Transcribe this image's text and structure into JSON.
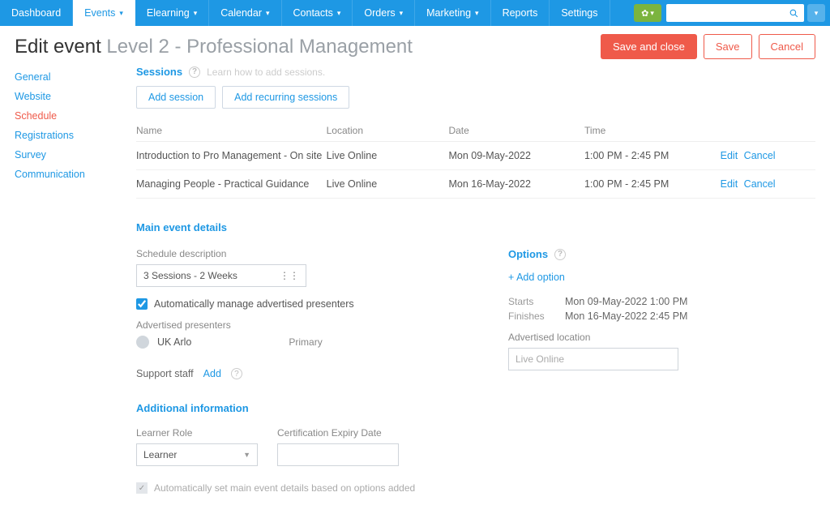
{
  "nav": {
    "items": [
      {
        "label": "Dashboard",
        "active": false,
        "caret": false
      },
      {
        "label": "Events",
        "active": true,
        "caret": true
      },
      {
        "label": "Elearning",
        "active": false,
        "caret": true
      },
      {
        "label": "Calendar",
        "active": false,
        "caret": true
      },
      {
        "label": "Contacts",
        "active": false,
        "caret": true
      },
      {
        "label": "Orders",
        "active": false,
        "caret": true
      },
      {
        "label": "Marketing",
        "active": false,
        "caret": true
      },
      {
        "label": "Reports",
        "active": false,
        "caret": false
      },
      {
        "label": "Settings",
        "active": false,
        "caret": false
      }
    ]
  },
  "header": {
    "edit_label": "Edit event",
    "event_name": "Level 2 - Professional Management"
  },
  "actions": {
    "save_close": "Save and close",
    "save": "Save",
    "cancel": "Cancel"
  },
  "sidebar": {
    "items": [
      {
        "label": "General",
        "active": false
      },
      {
        "label": "Website",
        "active": false
      },
      {
        "label": "Schedule",
        "active": true
      },
      {
        "label": "Registrations",
        "active": false
      },
      {
        "label": "Survey",
        "active": false
      },
      {
        "label": "Communication",
        "active": false
      }
    ]
  },
  "sessions": {
    "title": "Sessions",
    "learn": "Learn how to add sessions.",
    "add_session": "Add session",
    "add_recurring": "Add recurring sessions",
    "columns": {
      "name": "Name",
      "location": "Location",
      "date": "Date",
      "time": "Time"
    },
    "rows": [
      {
        "name": "Introduction to Pro Management - On site",
        "location": "Live Online",
        "date": "Mon 09-May-2022",
        "time": "1:00 PM - 2:45 PM",
        "edit": "Edit",
        "cancel": "Cancel"
      },
      {
        "name": "Managing People - Practical Guidance",
        "location": "Live Online",
        "date": "Mon 16-May-2022",
        "time": "1:00 PM - 2:45 PM",
        "edit": "Edit",
        "cancel": "Cancel"
      }
    ]
  },
  "details": {
    "heading": "Main event details",
    "schedule_desc_label": "Schedule description",
    "schedule_desc_value": "3 Sessions - 2 Weeks",
    "auto_presenters_label": "Automatically manage advertised presenters",
    "adv_presenters_label": "Advertised presenters",
    "presenter_name": "UK Arlo",
    "presenter_role": "Primary",
    "support_label": "Support staff",
    "support_add": "Add",
    "options_label": "Options",
    "add_option": "+  Add option",
    "starts_label": "Starts",
    "starts_value": "Mon 09-May-2022 1:00 PM",
    "finishes_label": "Finishes",
    "finishes_value": "Mon 16-May-2022 2:45 PM",
    "adv_location_label": "Advertised location",
    "adv_location_value": "Live Online"
  },
  "additional": {
    "heading": "Additional information",
    "learner_role_label": "Learner Role",
    "learner_role_value": "Learner",
    "cert_expiry_label": "Certification Expiry Date",
    "auto_main_label": "Automatically set main event details based on options added"
  }
}
